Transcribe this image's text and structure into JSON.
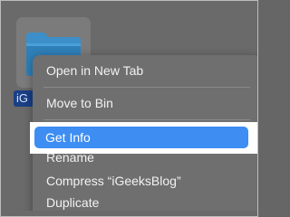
{
  "folder": {
    "label": "iG",
    "icon": "folder-icon"
  },
  "context_menu": {
    "items": [
      {
        "label": "Open in New Tab"
      },
      {
        "label": "Move to Bin"
      },
      {
        "label": "Get Info",
        "highlighted": true
      },
      {
        "label": "Rename"
      },
      {
        "label": "Compress “iGeeksBlog”"
      },
      {
        "label": "Duplicate"
      }
    ]
  },
  "colors": {
    "highlight": "#3d8df3",
    "menu_background": "#6f6f6f",
    "folder_blue": "#2f7fb8"
  }
}
